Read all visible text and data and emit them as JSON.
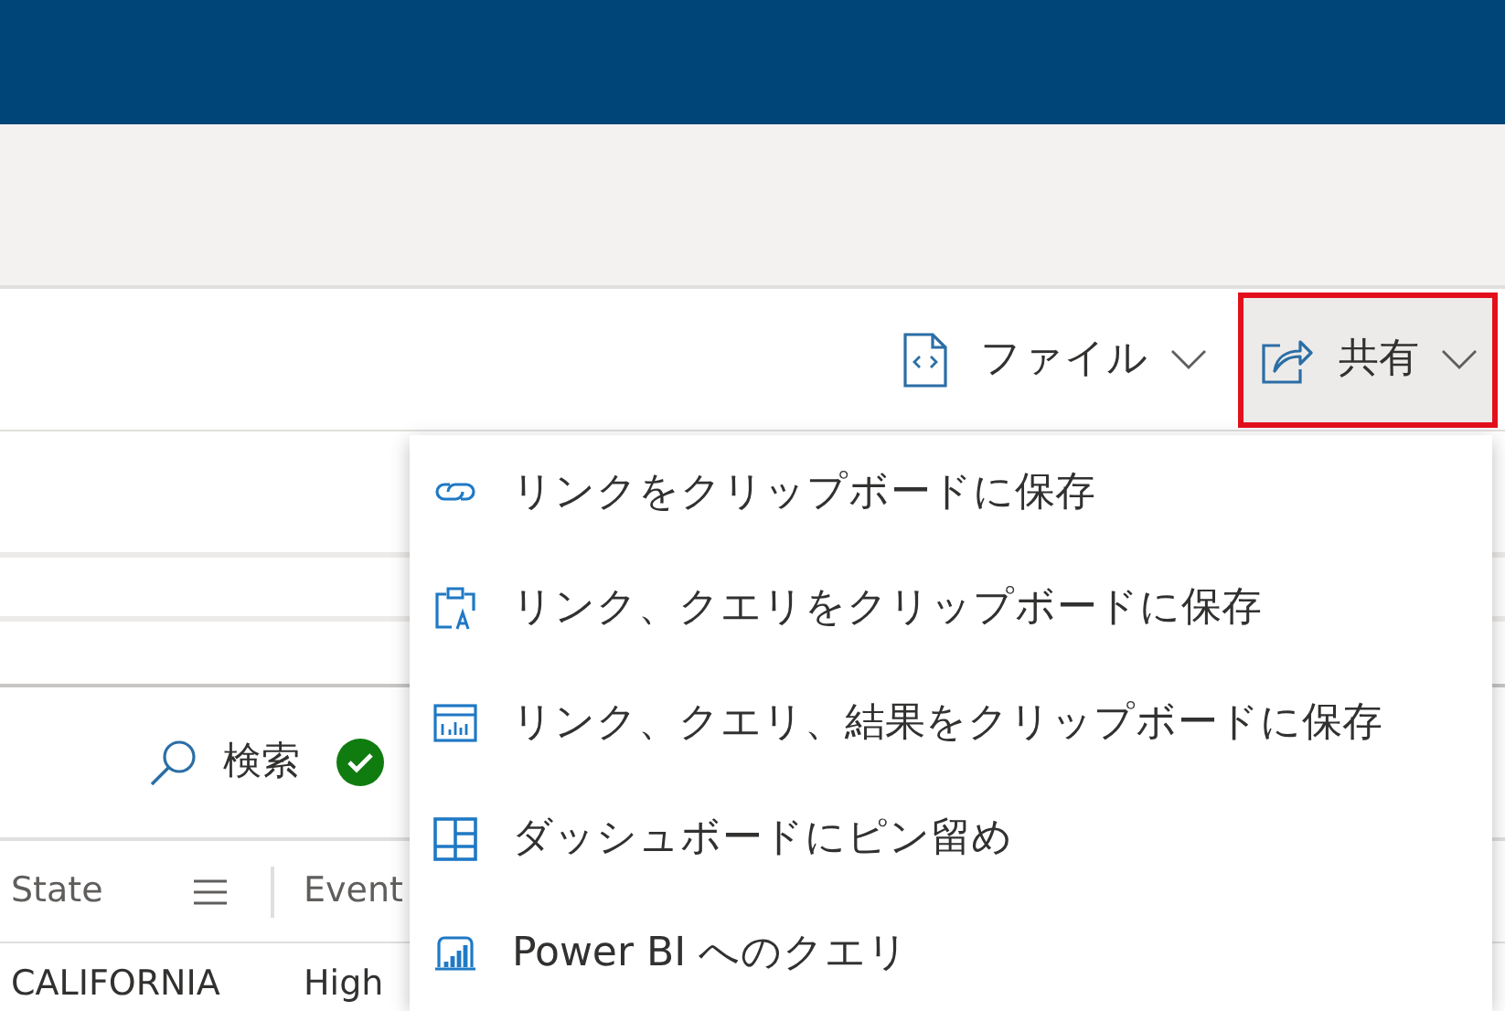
{
  "toolbar": {
    "buttons": [
      {
        "kind": "file",
        "label": "ファイル",
        "highlighted": false
      },
      {
        "kind": "share",
        "label": "共有",
        "highlighted": true
      }
    ]
  },
  "results": {
    "search_label": "検索",
    "columns": [
      {
        "label": "State"
      },
      {
        "label": "Event"
      }
    ],
    "rows": [
      [
        "CALIFORNIA",
        "High"
      ]
    ]
  },
  "share_menu": {
    "items": [
      {
        "kind": "link",
        "label": "リンクをクリップボードに保存"
      },
      {
        "kind": "link-query",
        "label": "リンク、クエリをクリップボードに保存"
      },
      {
        "kind": "link-query-results",
        "label": "リンク、クエリ、結果をクリップボードに保存"
      },
      {
        "kind": "dashboard",
        "label": "ダッシュボードにピン留め"
      },
      {
        "kind": "powerbi",
        "label": "Power BI へのクエリ"
      }
    ]
  }
}
